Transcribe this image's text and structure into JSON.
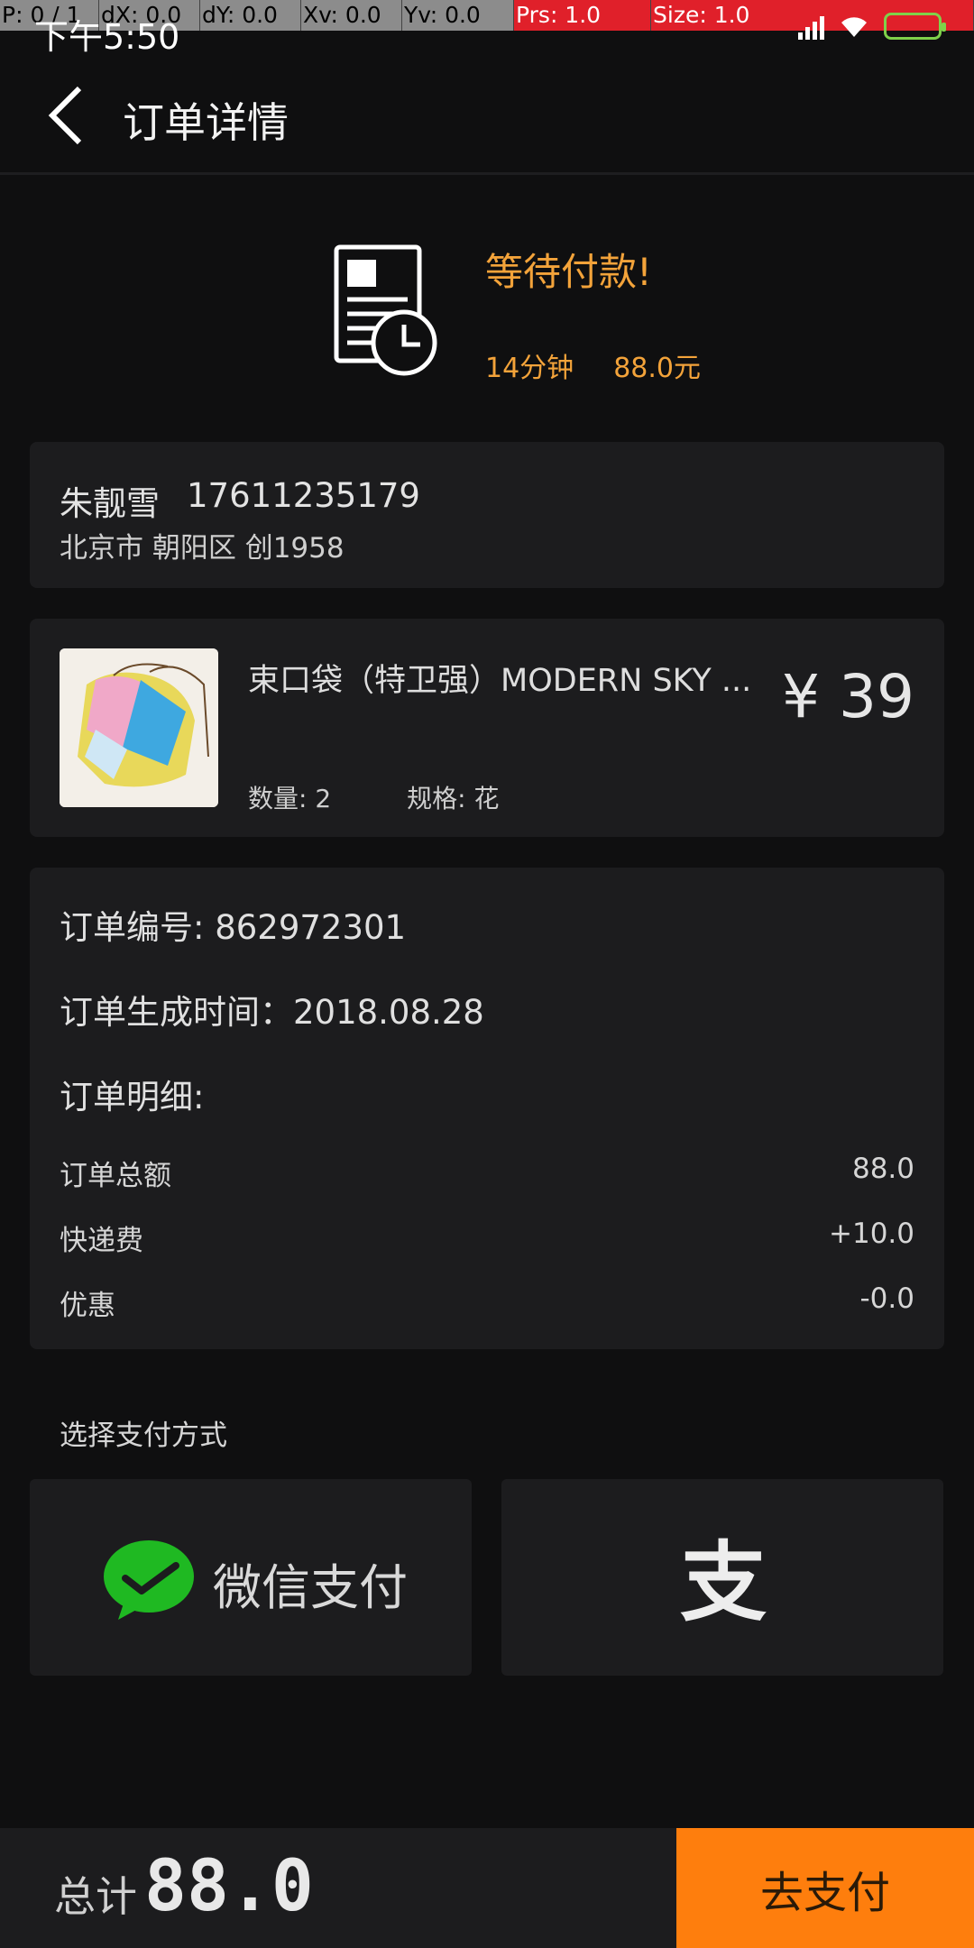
{
  "debug": {
    "p": "P: 0 / 1",
    "dx": "dX: 0.0",
    "dy": "dY: 0.0",
    "xv": "Xv: 0.0",
    "yv": "Yv: 0.0",
    "prs": "Prs: 1.0",
    "size": "Size: 1.0"
  },
  "status": {
    "time": "下午5:50"
  },
  "header": {
    "title": "订单详情"
  },
  "waiting": {
    "title": "等待付款!",
    "time_left": "14分钟",
    "amount": "88.0元"
  },
  "address": {
    "name": "朱靓雪",
    "phone": "17611235179",
    "location": "北京市 朝阳区  创1958"
  },
  "product": {
    "name": "束口袋（特卫强）MODERN SKY ...",
    "price": "¥ 39",
    "quantity": "数量: 2",
    "spec": "规格: 花"
  },
  "order": {
    "number": "订单编号: 862972301",
    "created": "订单生成时间：2018.08.28",
    "detail_label": "订单明细:",
    "fees": [
      {
        "label": "订单总额",
        "value": "88.0"
      },
      {
        "label": "快递费",
        "value": "+10.0"
      },
      {
        "label": "优惠",
        "value": "-0.0"
      }
    ]
  },
  "payment": {
    "label": "选择支付方式",
    "wechat_label": "微信支付",
    "alipay_glyph": "支"
  },
  "bottom": {
    "total_label": "总计",
    "total_value": "88.0",
    "pay_button": "去支付"
  },
  "colors": {
    "accent_orange": "#fe7e0d",
    "waiting_text": "#f3a33a",
    "wechat_green": "#1fb922"
  }
}
